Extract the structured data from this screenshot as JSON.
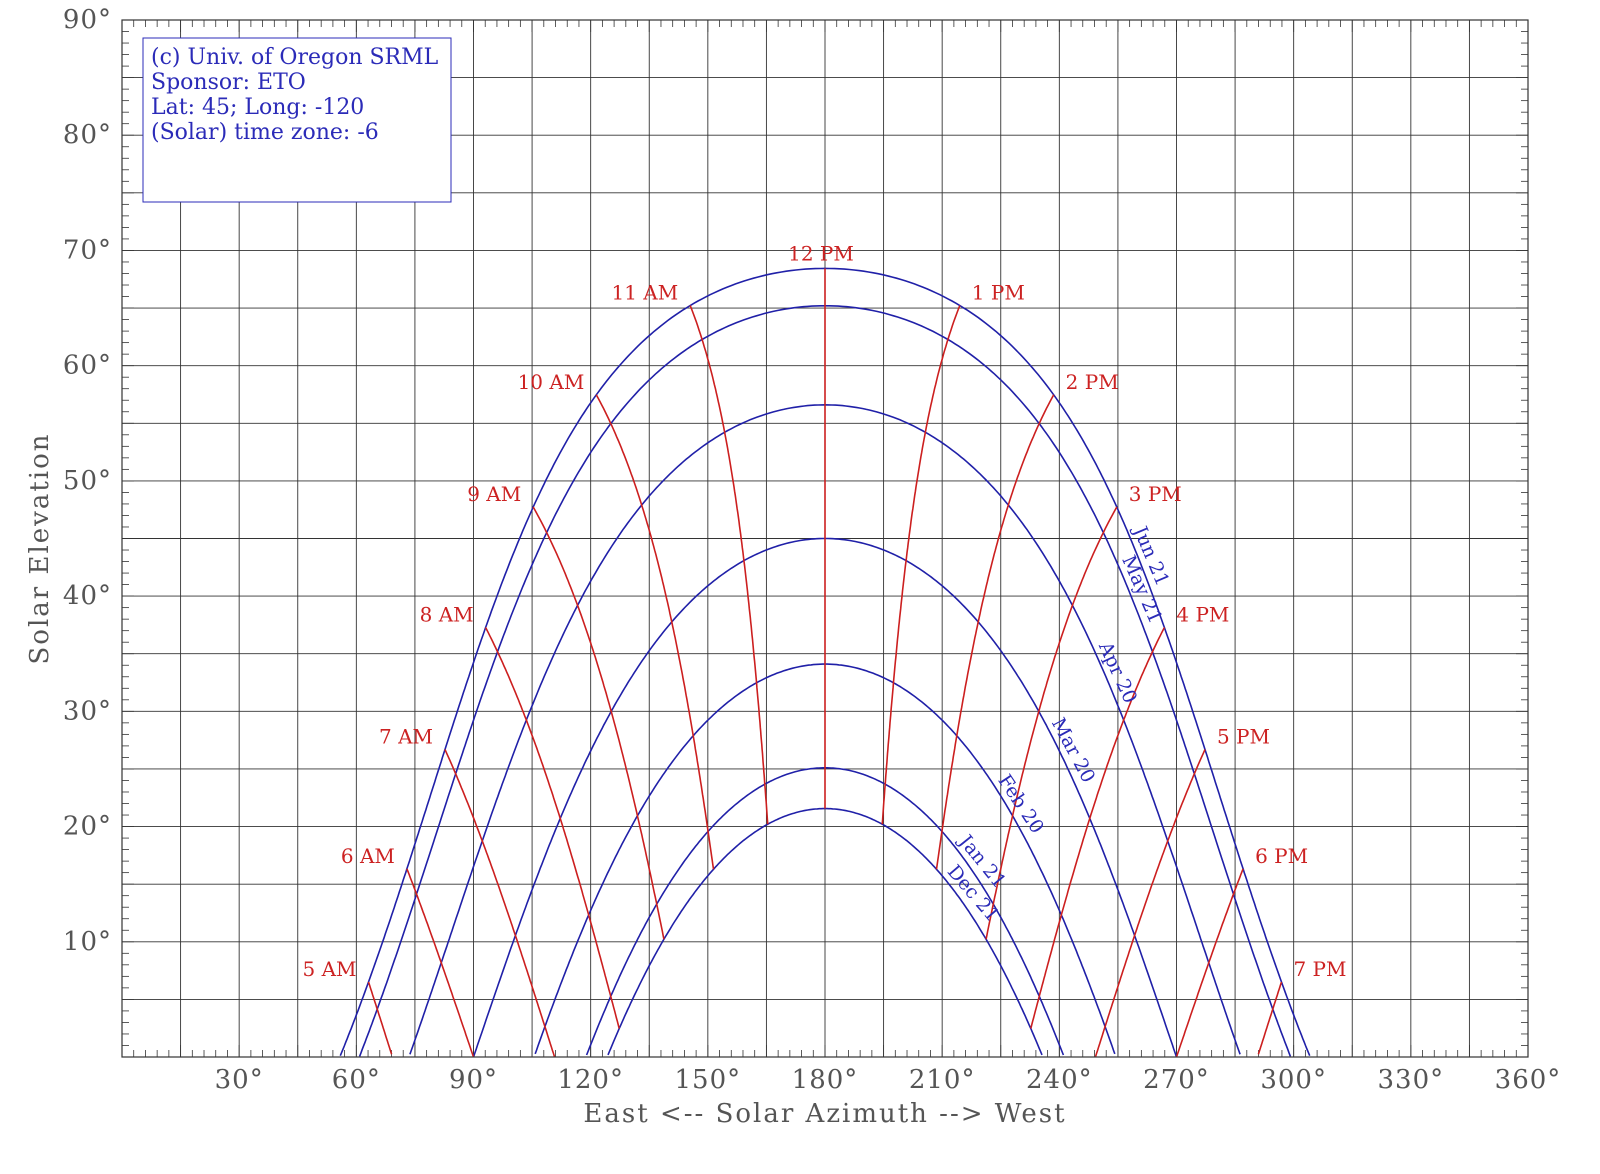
{
  "chart_data": {
    "type": "line",
    "xlabel": "East <-- Solar Azimuth --> West",
    "ylabel": "Solar Elevation",
    "xlim": [
      0,
      360
    ],
    "ylim": [
      0,
      90
    ],
    "x_ticks": [
      "30°",
      "60°",
      "90°",
      "120°",
      "150°",
      "180°",
      "210°",
      "240°",
      "270°",
      "300°",
      "330°",
      "360°"
    ],
    "y_ticks": [
      "10°",
      "20°",
      "30°",
      "40°",
      "50°",
      "60°",
      "70°",
      "80°",
      "90°"
    ],
    "grid": true,
    "colors": {
      "date_lines": "#2020a8",
      "hour_lines": "#cc1f1f",
      "grid": "#333333",
      "text": "#555555"
    },
    "info_box": [
      "(c) Univ. of Oregon SRML",
      "Sponsor: ETO",
      "Lat: 45; Long: -120",
      "(Solar) time zone: -6"
    ],
    "latitude": 45,
    "date_series": [
      {
        "name": "Jun 21",
        "declination": 23.44,
        "noon_elevation": 68.4
      },
      {
        "name": "May 21",
        "declination": 20.2,
        "noon_elevation": 65.3
      },
      {
        "name": "Apr 20",
        "declination": 11.6,
        "noon_elevation": 56.8
      },
      {
        "name": "Mar 20",
        "declination": 0.0,
        "noon_elevation": 45.2
      },
      {
        "name": "Feb 20",
        "declination": -10.9,
        "noon_elevation": 34.1
      },
      {
        "name": "Jan 21",
        "declination": -19.9,
        "noon_elevation": 25.1
      },
      {
        "name": "Dec 21",
        "declination": -23.44,
        "noon_elevation": 21.6
      }
    ],
    "hour_series": [
      {
        "name": "5 AM",
        "hour_angle": -105
      },
      {
        "name": "6 AM",
        "hour_angle": -90
      },
      {
        "name": "7 AM",
        "hour_angle": -75
      },
      {
        "name": "8 AM",
        "hour_angle": -60
      },
      {
        "name": "9 AM",
        "hour_angle": -45
      },
      {
        "name": "10 AM",
        "hour_angle": -30
      },
      {
        "name": "11 AM",
        "hour_angle": -15
      },
      {
        "name": "12 PM",
        "hour_angle": 0
      },
      {
        "name": "1 PM",
        "hour_angle": 15
      },
      {
        "name": "2 PM",
        "hour_angle": 30
      },
      {
        "name": "3 PM",
        "hour_angle": 45
      },
      {
        "name": "4 PM",
        "hour_angle": 60
      },
      {
        "name": "5 PM",
        "hour_angle": 75
      },
      {
        "name": "6 PM",
        "hour_angle": 90
      },
      {
        "name": "7 PM",
        "hour_angle": 105
      }
    ]
  }
}
